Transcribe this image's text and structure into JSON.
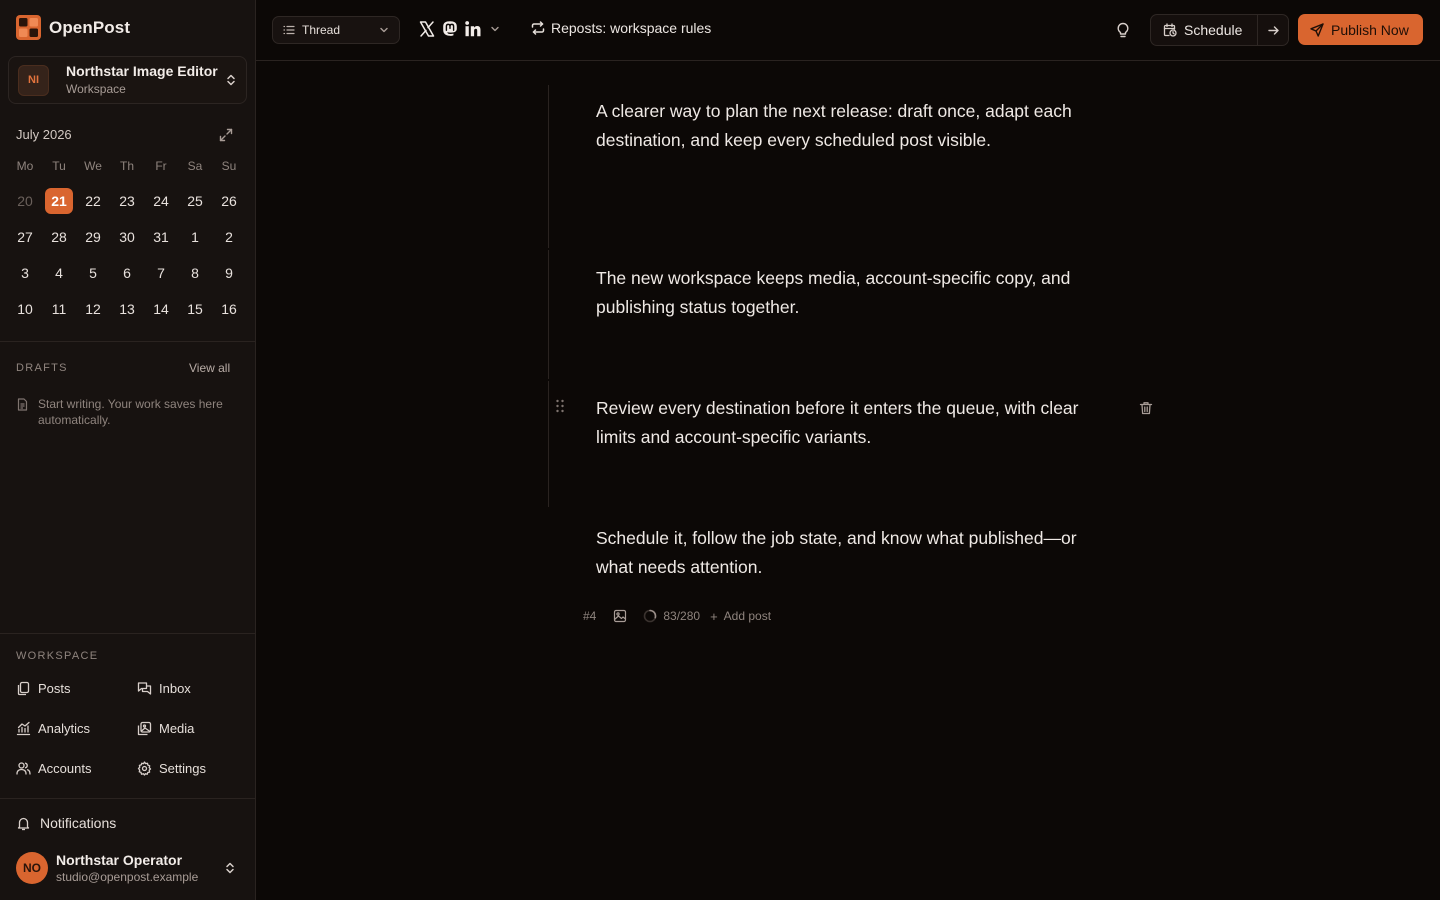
{
  "app": {
    "name": "OpenPost"
  },
  "workspace": {
    "initials": "NI",
    "name": "Northstar Image Editor",
    "subtitle": "Workspace"
  },
  "calendar": {
    "month_label": "July 2026",
    "weekdays": [
      "Mo",
      "Tu",
      "We",
      "Th",
      "Fr",
      "Sa",
      "Su"
    ],
    "days": [
      {
        "d": "20",
        "muted": true
      },
      {
        "d": "21",
        "today": true
      },
      {
        "d": "22"
      },
      {
        "d": "23"
      },
      {
        "d": "24"
      },
      {
        "d": "25"
      },
      {
        "d": "26"
      },
      {
        "d": "27"
      },
      {
        "d": "28"
      },
      {
        "d": "29"
      },
      {
        "d": "30"
      },
      {
        "d": "31"
      },
      {
        "d": "1"
      },
      {
        "d": "2"
      },
      {
        "d": "3"
      },
      {
        "d": "4"
      },
      {
        "d": "5"
      },
      {
        "d": "6"
      },
      {
        "d": "7"
      },
      {
        "d": "8"
      },
      {
        "d": "9"
      },
      {
        "d": "10"
      },
      {
        "d": "11"
      },
      {
        "d": "12"
      },
      {
        "d": "13"
      },
      {
        "d": "14"
      },
      {
        "d": "15"
      },
      {
        "d": "16"
      }
    ]
  },
  "drafts": {
    "title": "DRAFTS",
    "view_all": "View all",
    "empty_text": "Start writing. Your work saves here automatically."
  },
  "nav": {
    "section_title": "WORKSPACE",
    "items": [
      {
        "key": "posts",
        "label": "Posts"
      },
      {
        "key": "inbox",
        "label": "Inbox"
      },
      {
        "key": "analytics",
        "label": "Analytics"
      },
      {
        "key": "media",
        "label": "Media"
      },
      {
        "key": "accounts",
        "label": "Accounts"
      },
      {
        "key": "settings",
        "label": "Settings"
      }
    ],
    "notifications": "Notifications"
  },
  "user": {
    "initials": "NO",
    "name": "Northstar Operator",
    "email": "studio@openpost.example"
  },
  "toolbar": {
    "mode": "Thread",
    "accounts": [
      "x-icon",
      "mastodon-icon",
      "linkedin-icon"
    ],
    "reposts_label": "Reposts: workspace rules",
    "schedule_label": "Schedule",
    "publish_label": "Publish Now"
  },
  "posts": [
    {
      "text": "A clearer way to plan the next release: draft once, adapt each destination, and keep every scheduled post visible."
    },
    {
      "text": "The new workspace keeps media, account-specific copy, and publishing status together."
    },
    {
      "text": "Review every destination before it enters the queue, with clear limits and account-specific variants."
    },
    {
      "text": "Schedule it, follow the job state, and know what published—or what needs attention."
    }
  ],
  "active_post": {
    "index_label": "#4",
    "char_count": "83/280",
    "char_used": 83,
    "char_limit": 280,
    "add_post_label": "Add post"
  },
  "colors": {
    "accent": "#d9652f",
    "background": "#0c0806",
    "sidebar": "#171210"
  }
}
